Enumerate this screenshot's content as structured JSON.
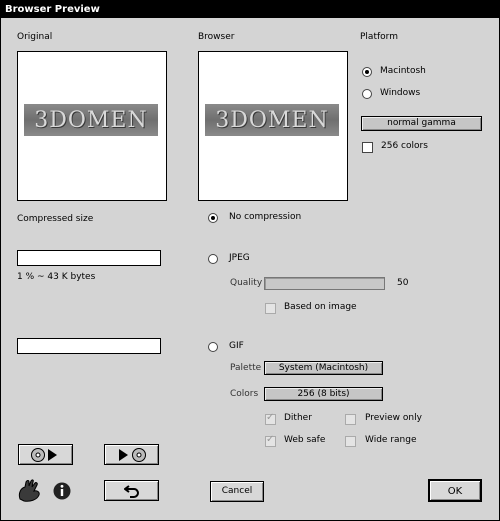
{
  "window": {
    "title": "Browser Preview"
  },
  "original": {
    "label": "Original",
    "logo_text": "3DOMEN"
  },
  "browser": {
    "label": "Browser",
    "logo_text": "3DOMEN"
  },
  "platform": {
    "label": "Platform",
    "mac_label": "Macintosh",
    "win_label": "Windows",
    "gamma_value": "normal gamma",
    "colors256_label": "256 colors"
  },
  "compressed": {
    "label": "Compressed size",
    "info": "1 %  ~ 43 K bytes"
  },
  "compression": {
    "none_label": "No compression",
    "jpeg_label": "JPEG",
    "quality_label": "Quality",
    "quality_value": "50",
    "based_label": "Based on image",
    "gif_label": "GIF",
    "palette_label": "Palette",
    "palette_value": "System (Macintosh)",
    "colors_label": "Colors",
    "colors_value": "256 (8 bits)",
    "dither_label": "Dither",
    "preview_only_label": "Preview only",
    "websafe_label": "Web safe",
    "wide_range_label": "Wide range"
  },
  "buttons": {
    "cancel": "Cancel",
    "ok": "OK"
  }
}
